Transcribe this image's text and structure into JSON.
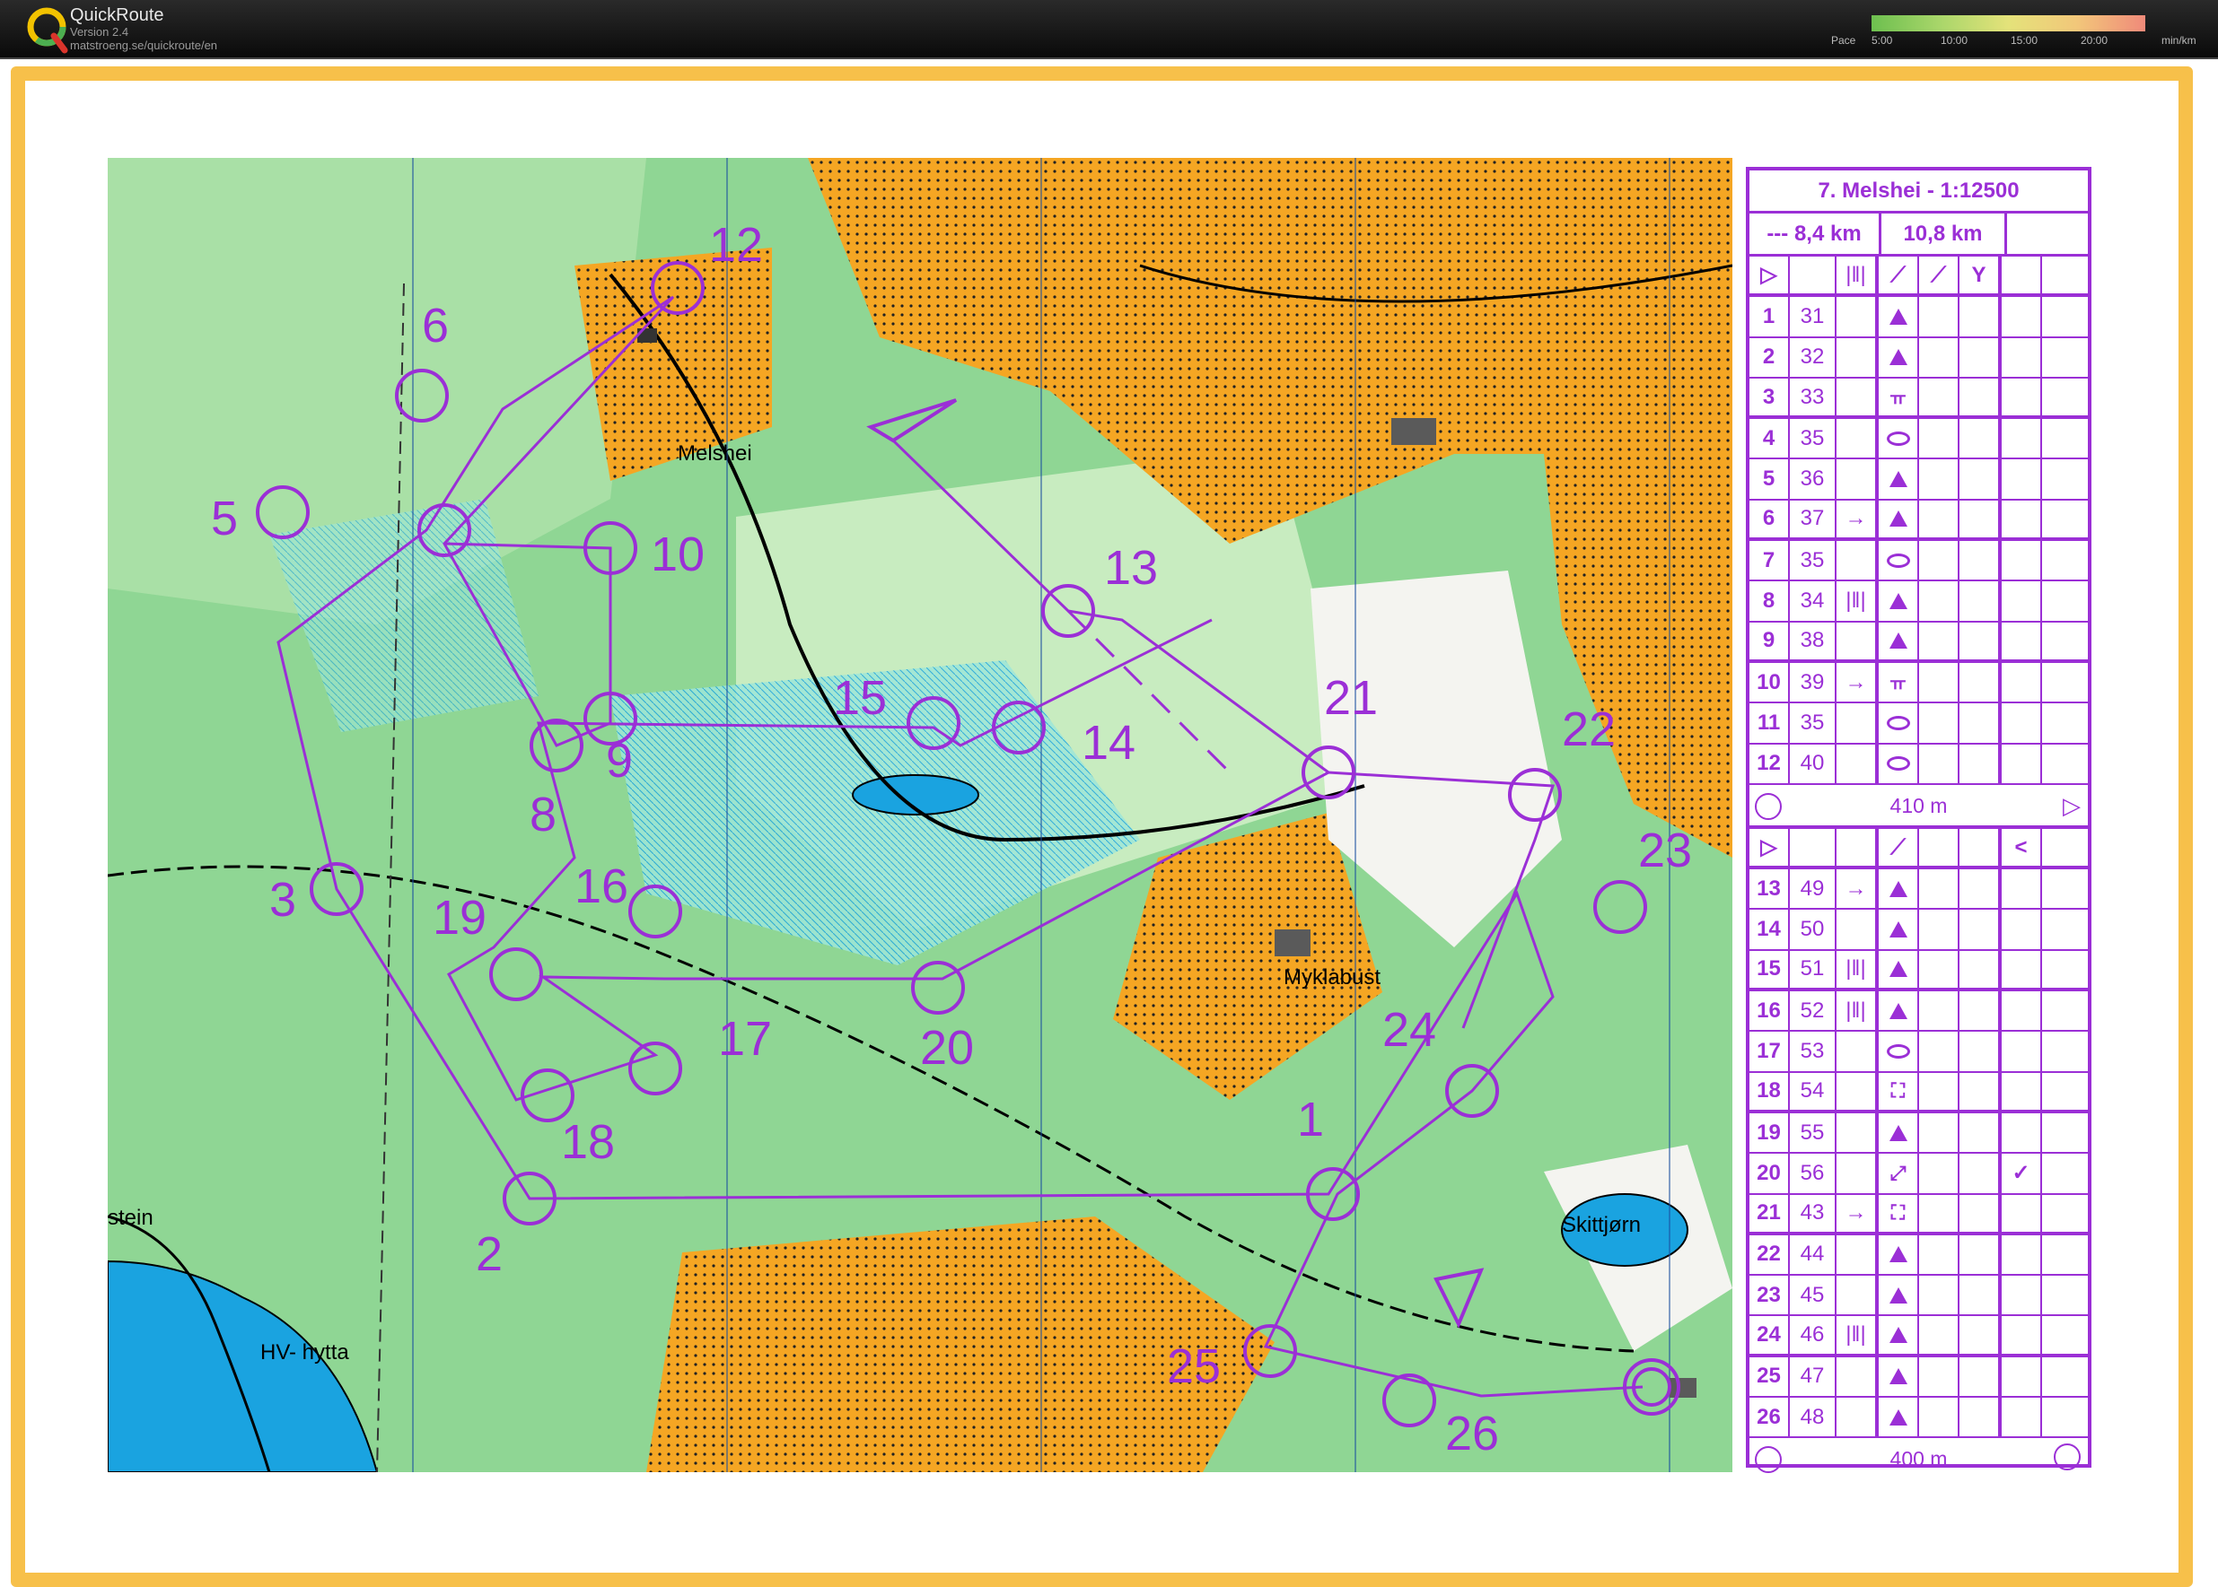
{
  "app": {
    "title": "QuickRoute",
    "version": "Version 2.4",
    "url": "matstroeng.se/quickroute/en"
  },
  "pace_scale": {
    "label": "Pace",
    "ticks": [
      "5:00",
      "10:00",
      "15:00",
      "20:00"
    ],
    "unit": "min/km"
  },
  "colors": {
    "course": "#9b2fd6",
    "frame": "#f7c04a",
    "open_land": "#f5a623",
    "forest": "#8fd694",
    "water": "#1aa3e0"
  },
  "map": {
    "place_names": [
      "Melshei",
      "Myklabust",
      "Skittjørn",
      "HV- hytta",
      "stein"
    ],
    "controls": [
      {
        "n": "1"
      },
      {
        "n": "2"
      },
      {
        "n": "3"
      },
      {
        "n": "5"
      },
      {
        "n": "6"
      },
      {
        "n": "8"
      },
      {
        "n": "9"
      },
      {
        "n": "10"
      },
      {
        "n": "12"
      },
      {
        "n": "13"
      },
      {
        "n": "14"
      },
      {
        "n": "15"
      },
      {
        "n": "16"
      },
      {
        "n": "17"
      },
      {
        "n": "18"
      },
      {
        "n": "19"
      },
      {
        "n": "20"
      },
      {
        "n": "21"
      },
      {
        "n": "22"
      },
      {
        "n": "23"
      },
      {
        "n": "24"
      },
      {
        "n": "25"
      },
      {
        "n": "26"
      }
    ]
  },
  "description_sheet": {
    "title": "7. Melshei - 1:12500",
    "length_a": "--- 8,4 km",
    "length_b": "10,8 km",
    "leg1": [
      {
        "n": "1",
        "code": "31",
        "dir": "",
        "sym": "tri"
      },
      {
        "n": "2",
        "code": "32",
        "dir": "",
        "sym": "tri"
      },
      {
        "n": "3",
        "code": "33",
        "dir": "",
        "sym": "fence"
      },
      {
        "n": "4",
        "code": "35",
        "dir": "",
        "sym": "oval"
      },
      {
        "n": "5",
        "code": "36",
        "dir": "",
        "sym": "tri"
      },
      {
        "n": "6",
        "code": "37",
        "dir": "→",
        "sym": "tri"
      },
      {
        "n": "7",
        "code": "35",
        "dir": "",
        "sym": "oval"
      },
      {
        "n": "8",
        "code": "34",
        "dir": "|‖|",
        "sym": "tri"
      },
      {
        "n": "9",
        "code": "38",
        "dir": "",
        "sym": "tri"
      },
      {
        "n": "10",
        "code": "39",
        "dir": "→",
        "sym": "fence"
      },
      {
        "n": "11",
        "code": "35",
        "dir": "",
        "sym": "oval"
      },
      {
        "n": "12",
        "code": "40",
        "dir": "",
        "sym": "oval"
      }
    ],
    "map_exchange": "410 m",
    "leg2": [
      {
        "n": "13",
        "code": "49",
        "dir": "→",
        "sym": "tri"
      },
      {
        "n": "14",
        "code": "50",
        "dir": "",
        "sym": "tri"
      },
      {
        "n": "15",
        "code": "51",
        "dir": "|‖|",
        "sym": "tri"
      },
      {
        "n": "16",
        "code": "52",
        "dir": "|‖|",
        "sym": "tri"
      },
      {
        "n": "17",
        "code": "53",
        "dir": "",
        "sym": "oval"
      },
      {
        "n": "18",
        "code": "54",
        "dir": "",
        "sym": "box"
      },
      {
        "n": "19",
        "code": "55",
        "dir": "",
        "sym": "tri"
      },
      {
        "n": "20",
        "code": "56",
        "dir": "",
        "sym": "ridge"
      },
      {
        "n": "21",
        "code": "43",
        "dir": "→",
        "sym": "box"
      },
      {
        "n": "22",
        "code": "44",
        "dir": "",
        "sym": "tri"
      },
      {
        "n": "23",
        "code": "45",
        "dir": "",
        "sym": "tri"
      },
      {
        "n": "24",
        "code": "46",
        "dir": "|‖|",
        "sym": "tri"
      },
      {
        "n": "25",
        "code": "47",
        "dir": "",
        "sym": "tri"
      },
      {
        "n": "26",
        "code": "48",
        "dir": "",
        "sym": "tri"
      }
    ],
    "finish": "400 m"
  }
}
